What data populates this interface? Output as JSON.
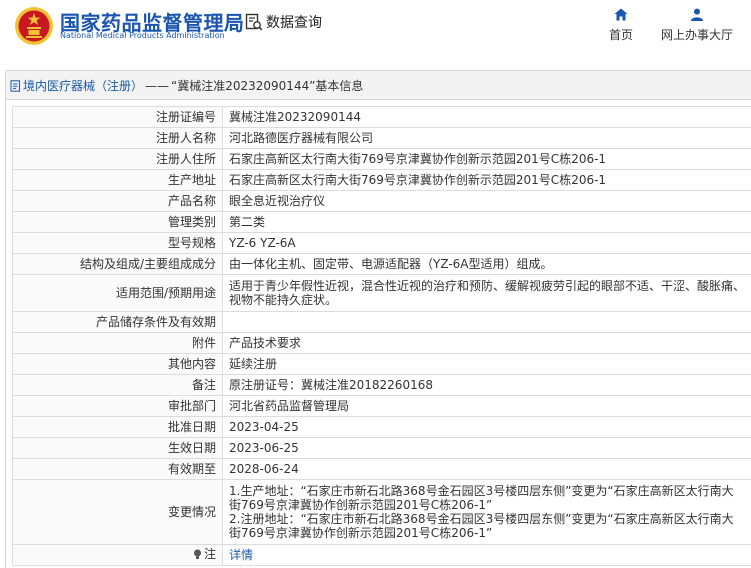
{
  "header": {
    "logo_cn": "国家药品监督管理局",
    "logo_en": "National Medical Products Administration",
    "search_label": "数据查询",
    "nav": [
      {
        "label": "首页",
        "icon": "home-icon"
      },
      {
        "label": "网上办事大厅",
        "icon": "user-icon"
      }
    ],
    "colors": {
      "brand_blue": "#1a56b0",
      "emblem_red": "#c8171e",
      "emblem_gold": "#f1c232"
    }
  },
  "panel": {
    "crumb": "境内医疗器械（注册）",
    "crumb_sep": "——",
    "title_tail": "“冀械注准20232090144”基本信息"
  },
  "rows": [
    {
      "key": "注册证编号",
      "value": "冀械注准20232090144"
    },
    {
      "key": "注册人名称",
      "value": "河北路德医疗器械有限公司"
    },
    {
      "key": "注册人住所",
      "value": "石家庄高新区太行南大街769号京津冀协作创新示范园201号C栋206-1"
    },
    {
      "key": "生产地址",
      "value": "石家庄高新区太行南大街769号京津冀协作创新示范园201号C栋206-1"
    },
    {
      "key": "产品名称",
      "value": "眼全息近视治疗仪"
    },
    {
      "key": "管理类别",
      "value": "第二类"
    },
    {
      "key": "型号规格",
      "value": "YZ-6 YZ-6A"
    },
    {
      "key": "结构及组成/主要组成成分",
      "value": "由一体化主机、固定带、电源适配器（YZ-6A型适用）组成。"
    },
    {
      "key": "适用范围/预期用途",
      "value": "适用于青少年假性近视，混合性近视的治疗和预防、缓解视疲劳引起的眼部不适、干涩、酸胀痛、视物不能持久症状。"
    },
    {
      "key": "产品储存条件及有效期",
      "value": ""
    },
    {
      "key": "附件",
      "value": "产品技术要求"
    },
    {
      "key": "其他内容",
      "value": "延续注册"
    },
    {
      "key": "备注",
      "value": "原注册证号：冀械注准20182260168"
    },
    {
      "key": "审批部门",
      "value": "河北省药品监督管理局"
    },
    {
      "key": "批准日期",
      "value": "2023-04-25"
    },
    {
      "key": "生效日期",
      "value": "2023-06-25"
    },
    {
      "key": "有效期至",
      "value": "2028-06-24"
    },
    {
      "key": "变更情况",
      "value": "1.生产地址：“石家庄市新石北路368号金石园区3号楼四层东侧”变更为“石家庄高新区太行南大街769号京津冀协作创新示范园201号C栋206-1”\n2.注册地址：“石家庄市新石北路368号金石园区3号楼四层东侧”变更为“石家庄高新区太行南大街769号京津冀协作创新示范园201号C栋206-1”"
    }
  ],
  "note": {
    "key": "注",
    "icon": "bulb-icon",
    "link": "详情"
  }
}
